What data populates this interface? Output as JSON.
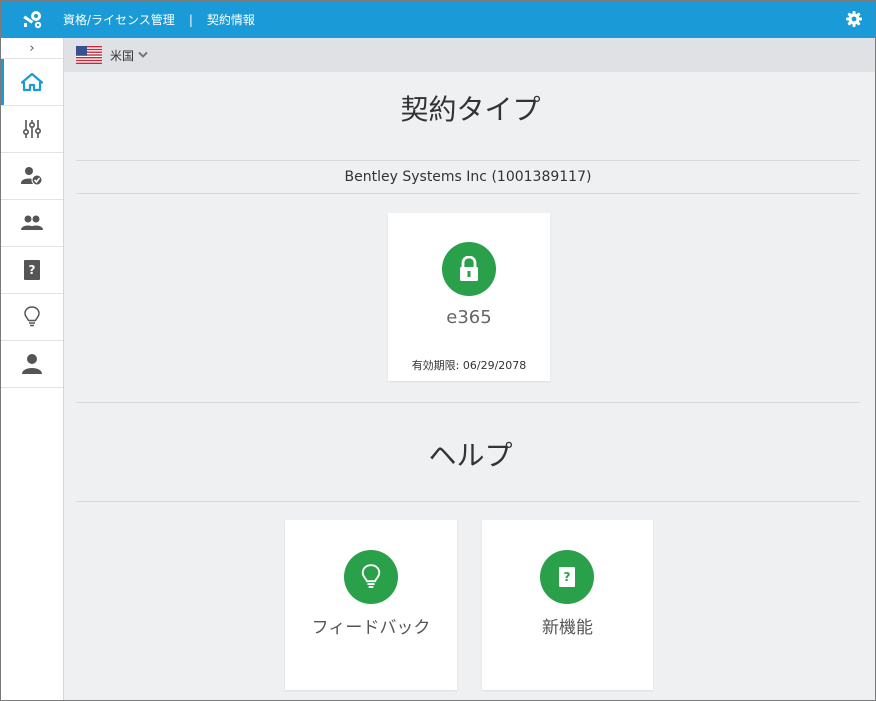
{
  "header": {
    "app_title": "資格/ライセンス管理",
    "separator": "|",
    "page_title": "契約情報",
    "logo_icon": "key-gear-icon",
    "settings_icon": "gear-icon"
  },
  "sidebar": {
    "expand_glyph": "›",
    "items": [
      {
        "name": "home",
        "icon": "home-icon",
        "active": true
      },
      {
        "name": "settings-sliders",
        "icon": "sliders-icon",
        "active": false
      },
      {
        "name": "user-verified",
        "icon": "user-check-icon",
        "active": false
      },
      {
        "name": "users",
        "icon": "users-icon",
        "active": false
      },
      {
        "name": "help-book",
        "icon": "book-question-icon",
        "active": false
      },
      {
        "name": "ideas",
        "icon": "lightbulb-icon",
        "active": false
      },
      {
        "name": "profile",
        "icon": "user-icon",
        "active": false
      }
    ]
  },
  "region": {
    "country": "米国",
    "flag_icon": "us-flag-icon",
    "dropdown_icon": "chevron-down-icon"
  },
  "contract": {
    "section_title": "契約タイプ",
    "company": "Bentley Systems Inc (1001389117)",
    "card": {
      "icon": "lock-icon",
      "name": "e365",
      "expiry": "有効期限: 06/29/2078"
    }
  },
  "help": {
    "section_title": "ヘルプ",
    "cards": [
      {
        "icon": "lightbulb-icon",
        "label": "フィードバック"
      },
      {
        "icon": "book-question-icon",
        "label": "新機能"
      }
    ]
  },
  "colors": {
    "header": "#1a9bd7",
    "accent_green": "#2aa04b",
    "background": "#eff0f2"
  }
}
